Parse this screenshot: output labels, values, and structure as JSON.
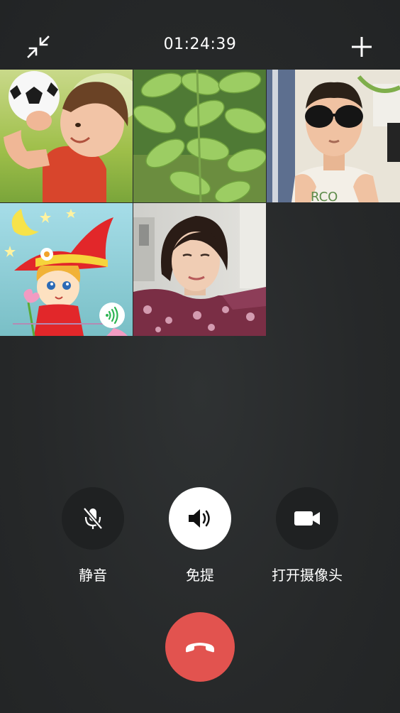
{
  "call": {
    "timer": "01:24:39"
  },
  "topbar": {
    "minimize_icon": "collapse-arrows-icon",
    "add_icon": "plus-icon"
  },
  "participants": [
    {
      "tile": "participant-1",
      "depicts": "toddler-with-soccer-ball",
      "active": true
    },
    {
      "tile": "participant-2",
      "depicts": "green-leaves",
      "active": false
    },
    {
      "tile": "participant-3",
      "depicts": "boy-with-sunglasses",
      "active": false
    },
    {
      "tile": "participant-4",
      "depicts": "cartoon-girl-red-hat",
      "active": false,
      "speaking": true
    },
    {
      "tile": "participant-5",
      "depicts": "woman-selfie",
      "active": false
    }
  ],
  "controls": {
    "mute_label": "静音",
    "speaker_label": "免提",
    "camera_label": "打开摄像头"
  },
  "colors": {
    "background": "#262829",
    "hangup": "#e2534f",
    "speaking_indicator": "#2db553",
    "active_tile_border": "#1b78c9"
  }
}
